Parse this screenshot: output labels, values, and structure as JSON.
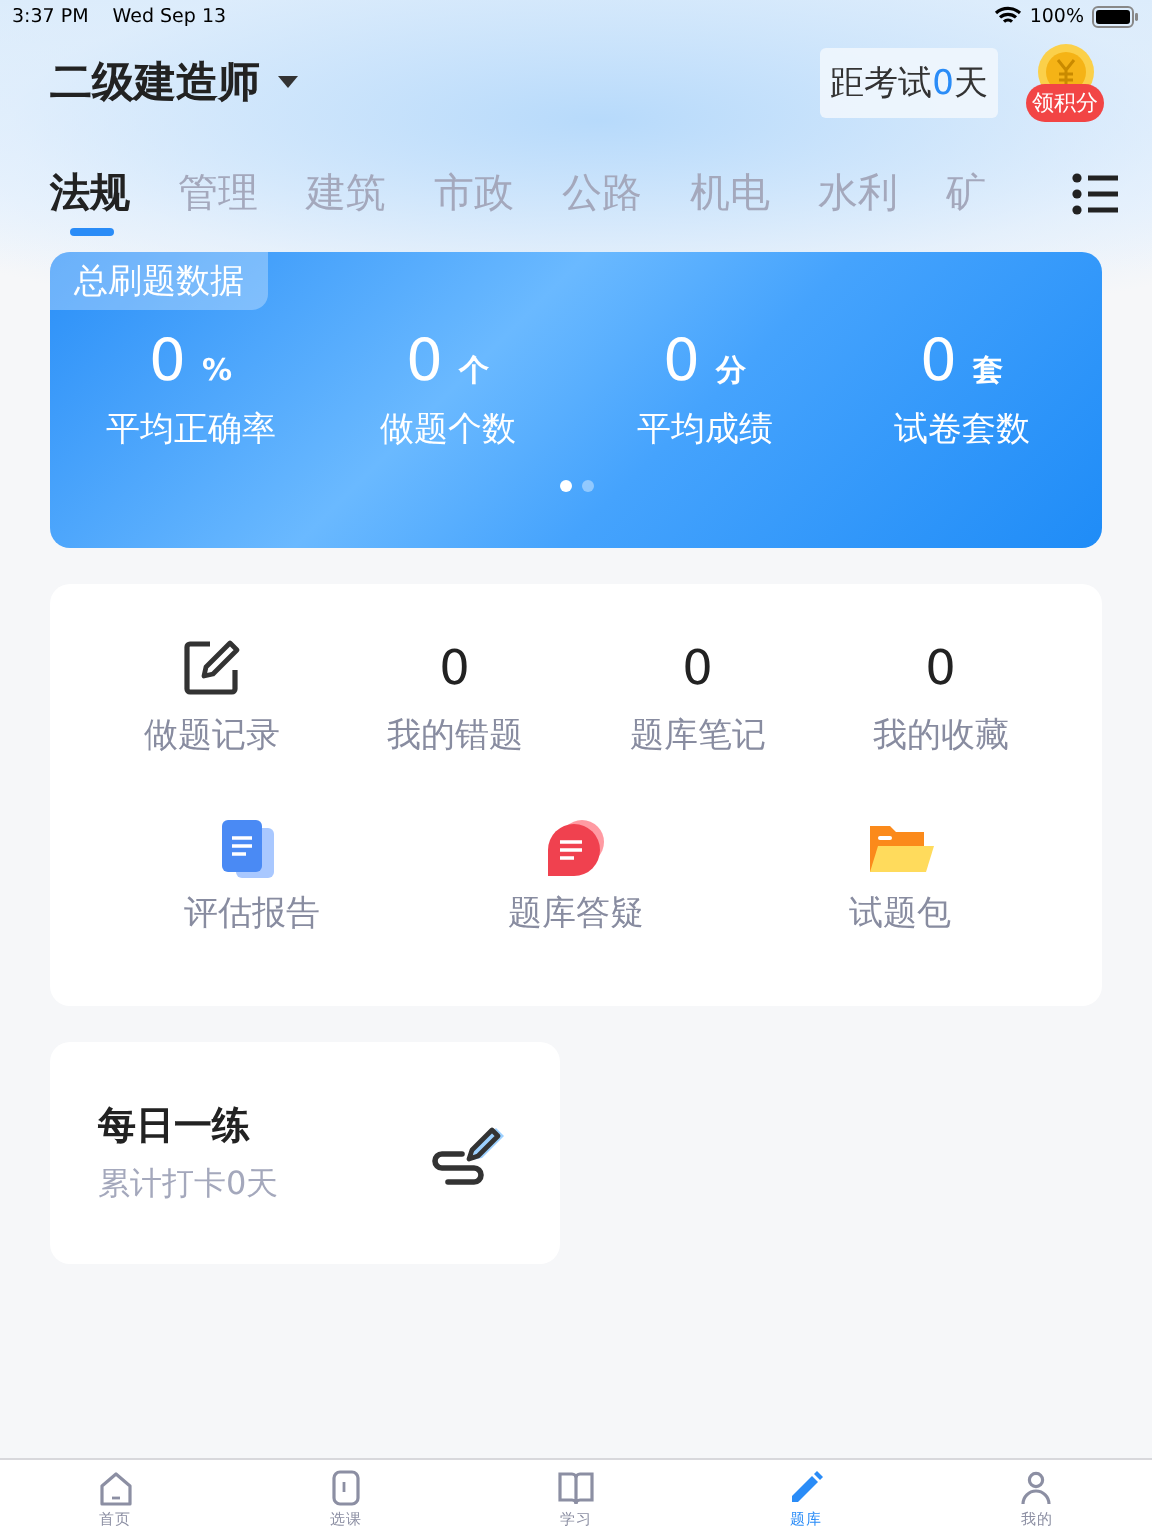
{
  "status_bar": {
    "time": "3:37 PM",
    "date": "Wed Sep 13",
    "battery": "100%"
  },
  "header": {
    "title": "二级建造师",
    "countdown": {
      "prefix": "距考试",
      "value": "0",
      "suffix": "天"
    },
    "reward": "领积分"
  },
  "tabs": [
    {
      "label": "法规",
      "selected": true
    },
    {
      "label": "管理",
      "selected": false
    },
    {
      "label": "建筑",
      "selected": false
    },
    {
      "label": "市政",
      "selected": false
    },
    {
      "label": "公路",
      "selected": false
    },
    {
      "label": "机电",
      "selected": false
    },
    {
      "label": "水利",
      "selected": false
    },
    {
      "label": "矿",
      "selected": false
    }
  ],
  "stats_card": {
    "title": "总刷题数据",
    "stats": [
      {
        "value": "0",
        "unit": "%",
        "label": "平均正确率"
      },
      {
        "value": "0",
        "unit": "个",
        "label": "做题个数"
      },
      {
        "value": "0",
        "unit": "分",
        "label": "平均成绩"
      },
      {
        "value": "0",
        "unit": "套",
        "label": "试卷套数"
      }
    ],
    "pages": [
      {
        "selected": true
      },
      {
        "selected": false
      }
    ]
  },
  "shortcuts": [
    {
      "kind": "icon",
      "label": "做题记录"
    },
    {
      "kind": "count",
      "value": "0",
      "label": "我的错题"
    },
    {
      "kind": "count",
      "value": "0",
      "label": "题库笔记"
    },
    {
      "kind": "count",
      "value": "0",
      "label": "我的收藏"
    }
  ],
  "features": [
    {
      "kind": "report",
      "label": "评估报告"
    },
    {
      "kind": "qa",
      "label": "题库答疑"
    },
    {
      "kind": "folder",
      "label": "试题包"
    }
  ],
  "daily": {
    "title": "每日一练",
    "subtitle": "累计打卡0天"
  },
  "bottom_nav": [
    {
      "kind": "home",
      "label": "首页",
      "selected": false
    },
    {
      "kind": "course",
      "label": "选课",
      "selected": false
    },
    {
      "kind": "book",
      "label": "学习",
      "selected": false
    },
    {
      "kind": "pen",
      "label": "题库",
      "selected": true
    },
    {
      "kind": "person",
      "label": "我的",
      "selected": false
    }
  ]
}
